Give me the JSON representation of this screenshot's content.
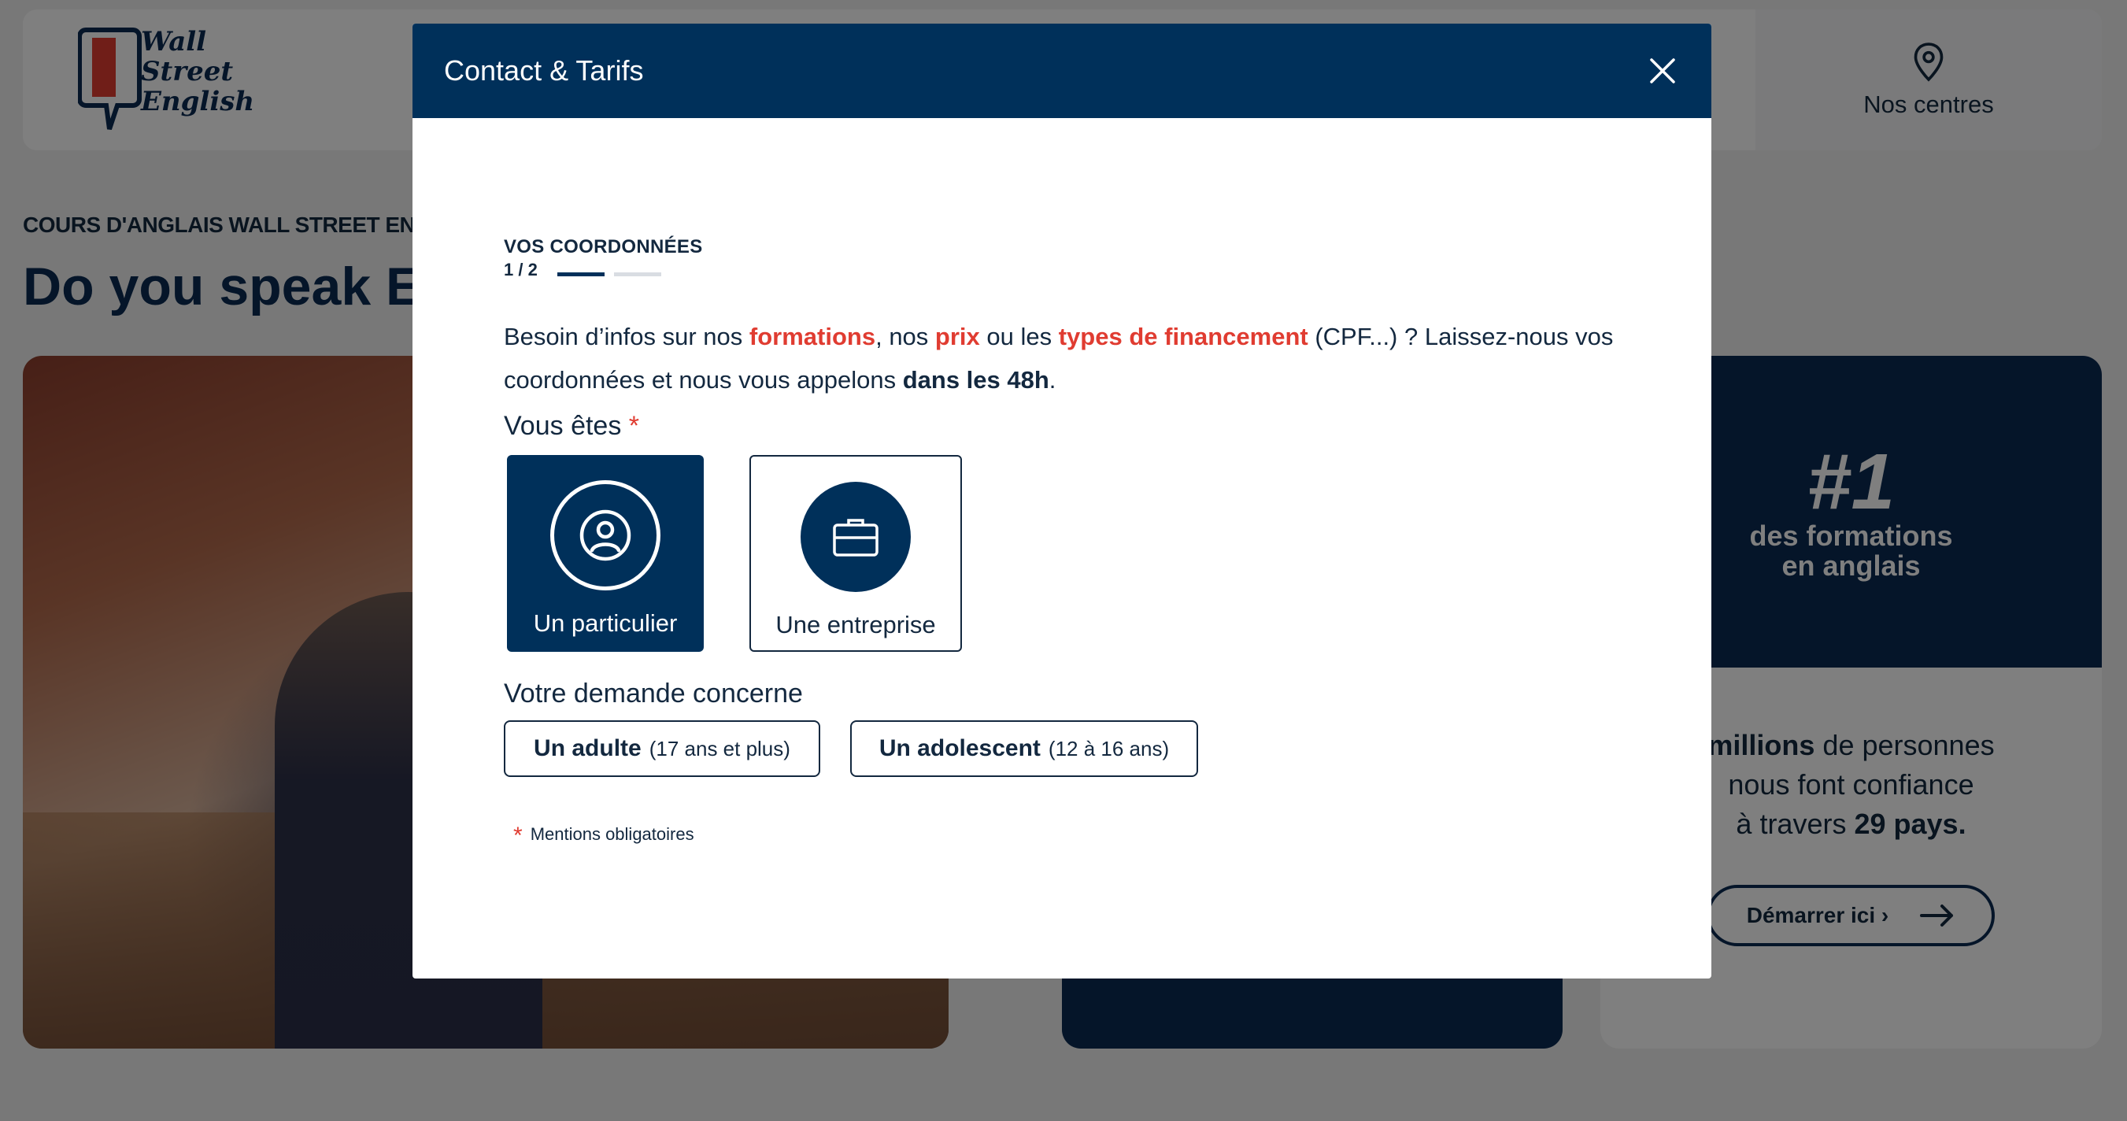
{
  "brand": {
    "logo_text_1": "Wall",
    "logo_text_2": "Street",
    "logo_text_3": "English"
  },
  "header": {
    "centres_label": "Nos centres"
  },
  "hero": {
    "eyebrow": "COURS D'ANGLAIS WALL STREET ENGLISH",
    "title": "Do you speak English?"
  },
  "promo": {
    "number": "#1",
    "label_line1": "des formations",
    "label_line2": "en anglais",
    "text_pre": "",
    "text_bold1": "millions",
    "text_mid": " de personnes",
    "text_line2": "nous font confiance",
    "text_line3_pre": "à travers ",
    "text_bold2": "29 pays.",
    "cta": "Démarrer ici ›"
  },
  "modal": {
    "title": "Contact & Tarifs",
    "step_title": "VOS COORDONNÉES",
    "step_count": "1 / 2",
    "intro": {
      "p1": "Besoin d’infos sur nos ",
      "hl1": "formations",
      "p2": ", nos ",
      "hl2": "prix",
      "p3": " ou les ",
      "hl3": "types de financement",
      "p4": " (CPF...) ? Laissez-nous vos coordonnées et nous vous appelons ",
      "b1": "dans les 48h",
      "p5": "."
    },
    "q1_label": "Vous êtes",
    "required_mark": "*",
    "types": [
      {
        "label": "Un particulier",
        "selected": true
      },
      {
        "label": "Une entreprise",
        "selected": false
      }
    ],
    "q2_label": "Votre demande concerne",
    "ages": [
      {
        "label": "Un adulte",
        "note": "(17 ans et plus)"
      },
      {
        "label": "Un adolescent",
        "note": "(12 à 16 ans)"
      }
    ],
    "mandatory_note": "Mentions obligatoires"
  },
  "colors": {
    "navy": "#00305a",
    "accent": "#e03c31",
    "text": "#13283f"
  },
  "icons": [
    "location-pin-icon",
    "close-icon",
    "user-circle-icon",
    "briefcase-icon",
    "arrow-right-icon"
  ]
}
